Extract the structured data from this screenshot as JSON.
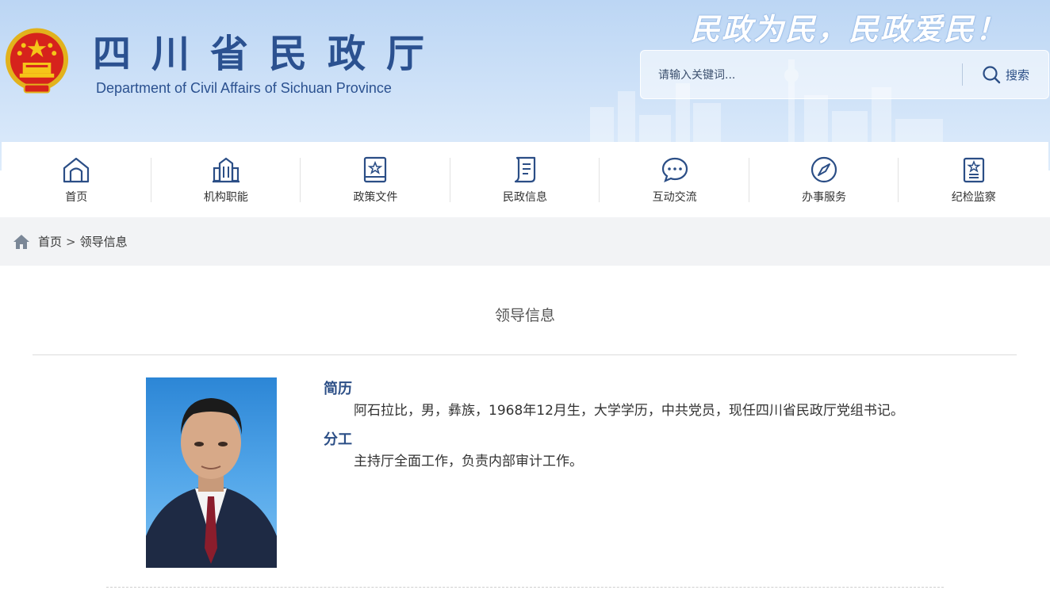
{
  "header": {
    "title_cn": "四川省民政厅",
    "title_en": "Department of Civil Affairs of Sichuan Province",
    "slogan": "民政为民，民政爱民！"
  },
  "search": {
    "placeholder": "请输入关键词...",
    "button_label": "搜索"
  },
  "nav": {
    "items": [
      {
        "label": "首页",
        "icon": "home-icon"
      },
      {
        "label": "机构职能",
        "icon": "building-icon"
      },
      {
        "label": "政策文件",
        "icon": "policy-book-icon"
      },
      {
        "label": "民政信息",
        "icon": "document-icon"
      },
      {
        "label": "互动交流",
        "icon": "chat-icon"
      },
      {
        "label": "办事服务",
        "icon": "compass-icon"
      },
      {
        "label": "纪检监察",
        "icon": "inspection-badge-icon"
      }
    ]
  },
  "breadcrumb": {
    "home": "首页",
    "separator": ">",
    "current": "领导信息"
  },
  "page": {
    "title": "领导信息"
  },
  "leader": {
    "resume_heading": "简历",
    "resume_text": "阿石拉比，男，彝族，1968年12月生，大学学历，中共党员，现任四川省民政厅党组书记。",
    "duty_heading": "分工",
    "duty_text": "主持厅全面工作，负责内部审计工作。"
  },
  "colors": {
    "brand_blue": "#2b5190",
    "header_bg": "#c4dbf5",
    "breadcrumb_bg": "#f2f3f5",
    "emblem_red": "#d6231c",
    "emblem_gold": "#f5c518"
  }
}
